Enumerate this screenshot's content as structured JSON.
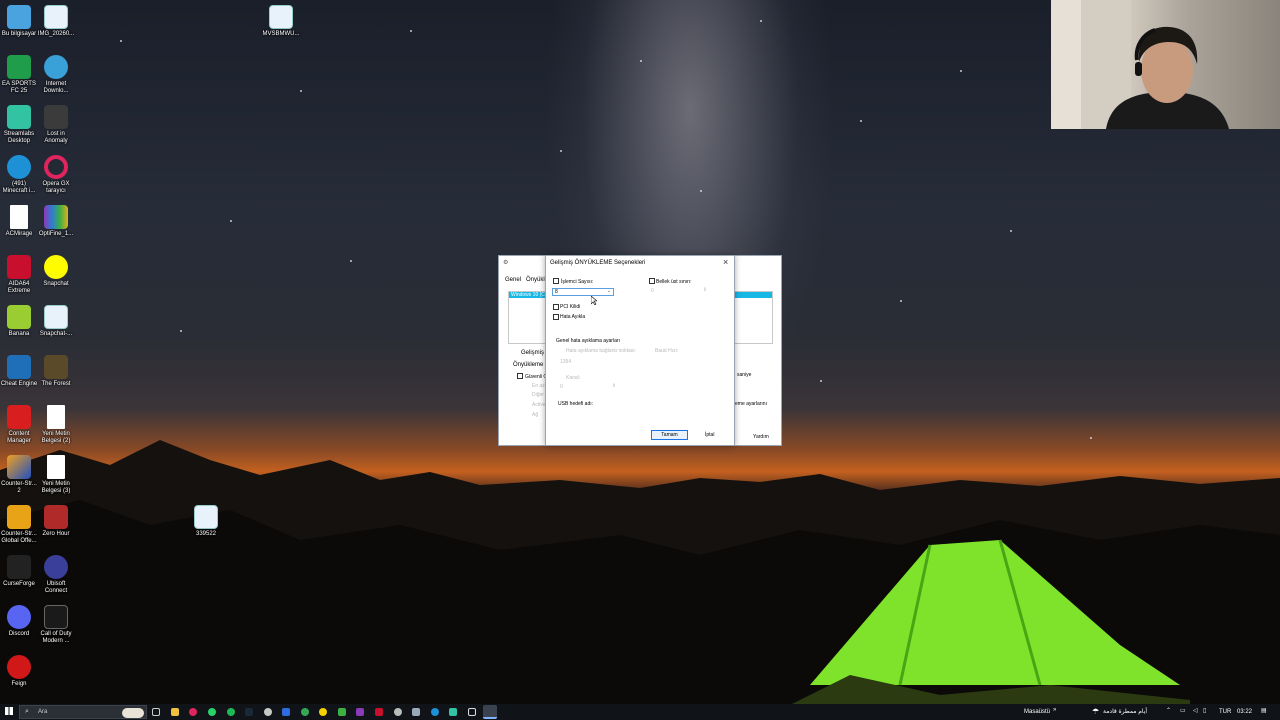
{
  "desktop": {
    "icons": [
      {
        "label": "Bu bilgisayar",
        "icon": "this-pc-icon",
        "color": "#4aa3df"
      },
      {
        "label": "IMG_20260...",
        "icon": "image-file-icon",
        "color": "#e8f2fb"
      },
      {
        "label": "MVSBMWU...",
        "icon": "image-file-icon",
        "color": "#e8f2fb"
      },
      {
        "label": "EA SPORTS FC 25",
        "icon": "ea-fc-icon",
        "color": "#1f9d4a"
      },
      {
        "label": "Internet Downlo...",
        "icon": "idm-icon",
        "color": "#3aa0d8"
      },
      {
        "label": "Streamlabs Desktop",
        "icon": "streamlabs-icon",
        "color": "#31c3a2"
      },
      {
        "label": "Lost in Anomaly",
        "icon": "game-icon",
        "color": "#3b3b3b"
      },
      {
        "label": "(491) Minecraft i...",
        "icon": "edge-icon",
        "color": "#1e90d6"
      },
      {
        "label": "Opera GX tarayıcı",
        "icon": "opera-gx-icon",
        "color": "#e0245e"
      },
      {
        "label": "ACMirage",
        "icon": "blank-file-icon",
        "color": "#ffffff"
      },
      {
        "label": "OptiFine_1...",
        "icon": "winrar-icon",
        "color": "#8a3bb7"
      },
      {
        "label": "AIDA64 Extreme",
        "icon": "aida64-icon",
        "color": "#c8102e"
      },
      {
        "label": "Snapchat",
        "icon": "snapchat-icon",
        "color": "#fffc00"
      },
      {
        "label": "Banana",
        "icon": "banana-icon",
        "color": "#9acd32"
      },
      {
        "label": "Snapchat-...",
        "icon": "image-file-icon",
        "color": "#e8f2fb"
      },
      {
        "label": "Cheat Engine",
        "icon": "cheat-engine-icon",
        "color": "#1e6fb8"
      },
      {
        "label": "The Forest",
        "icon": "the-forest-icon",
        "color": "#5a4a2a"
      },
      {
        "label": "Content Manager",
        "icon": "content-manager-icon",
        "color": "#d81e1e"
      },
      {
        "label": "Yeni Metin Belgesi (2)",
        "icon": "text-file-icon",
        "color": "#ffffff"
      },
      {
        "label": "Counter-Str... 2",
        "icon": "cs2-icon",
        "color": "#f0a020"
      },
      {
        "label": "Yeni Metin Belgesi (3)",
        "icon": "text-file-icon",
        "color": "#ffffff"
      },
      {
        "label": "Counter-Str... Global Offe...",
        "icon": "csgo-icon",
        "color": "#e8a317"
      },
      {
        "label": "Zero Hour",
        "icon": "zero-hour-icon",
        "color": "#b02a2a"
      },
      {
        "label": "339522",
        "icon": "image-file-icon",
        "color": "#e8f2fb"
      },
      {
        "label": "CurseForge",
        "icon": "curseforge-icon",
        "color": "#222222"
      },
      {
        "label": "Ubisoft Connect",
        "icon": "ubisoft-icon",
        "color": "#3a3f9a"
      },
      {
        "label": "Discord",
        "icon": "discord-icon",
        "color": "#5865f2"
      },
      {
        "label": "Call of Duty Modern ...",
        "icon": "cod-icon",
        "color": "#1a1a1a"
      },
      {
        "label": "Feign",
        "icon": "feign-icon",
        "color": "#d01818"
      }
    ]
  },
  "back_dialog": {
    "tabs": [
      "Genel",
      "Önyükle"
    ],
    "list_item": "Windows 10 (C",
    "advanced_label": "Gelişmiş Se",
    "boot_options_label": "Önyükleme Se",
    "safe_boot_label": "Güvenli C",
    "safe_options": [
      "En az",
      "Diğer",
      "Active",
      "Ağ"
    ],
    "seconds_label": "saniye",
    "settings_label": "eme ayarlarını",
    "help_label": "Yardım"
  },
  "dialog": {
    "title": "Gelişmiş ÖNYÜKLEME Seçenekleri",
    "close_glyph": "×",
    "processor_count_label": "İşlemci Sayısı:",
    "processor_count_value": "8",
    "memory_limit_label": "Bellek üst sınırı:",
    "memory_limit_value": "0",
    "pci_lock_label": "PCI Kilidi",
    "debug_label": "Hata Ayıkla",
    "debug_settings_label": "Genel hata ayıklama ayarları",
    "debug_port_label": "Hata ayıklama bağlantı noktası:",
    "baud_rate_label": "Baud Hızı:",
    "port_value": "1394",
    "channel_label": "Kanal:",
    "channel_value": "0",
    "usb_target_label": "USB hedefi adı:",
    "ok_label": "Tamam",
    "cancel_label": "İptal"
  },
  "taskbar": {
    "search_placeholder": "Ara",
    "desktop_label": "Masaüstü",
    "chevron": "»",
    "weather_text": "أيام ممطرة قادمة",
    "language": "TUR",
    "time": "03:22"
  }
}
